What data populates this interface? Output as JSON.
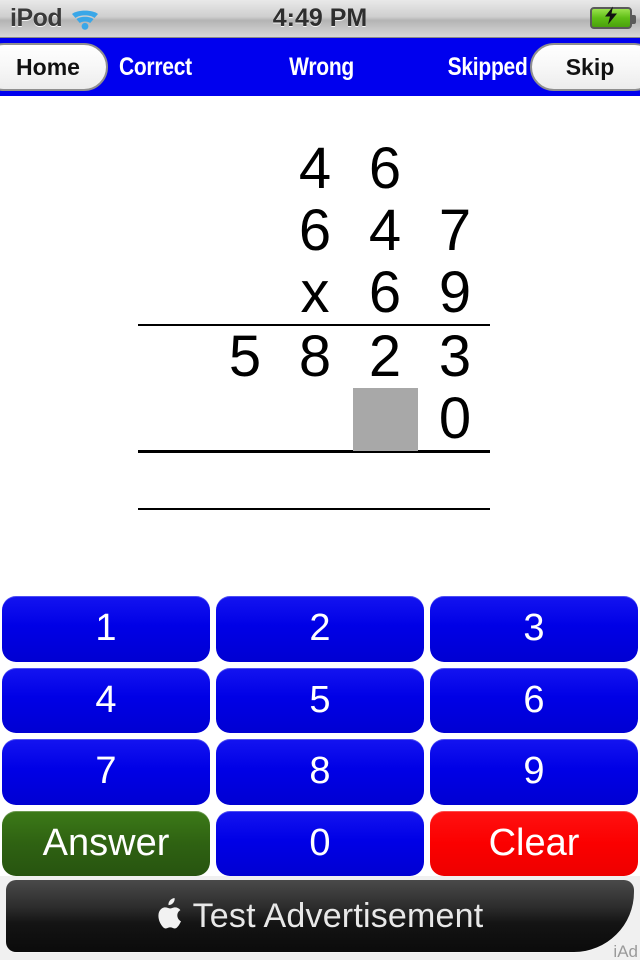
{
  "status_bar": {
    "carrier": "iPod",
    "wifi_icon": "wifi-icon",
    "time": "4:49 PM",
    "battery_icon": "battery-charging-icon"
  },
  "nav_bar": {
    "home_label": "Home",
    "correct_label": "Correct",
    "wrong_label": "Wrong",
    "skipped_label": "Skipped",
    "skip_label": "Skip",
    "background_color": "#0000ee"
  },
  "problem": {
    "type": "long-multiplication",
    "carry_row": [
      "",
      "",
      "4",
      "6",
      ""
    ],
    "multiplicand": [
      "",
      "",
      "6",
      "4",
      "7"
    ],
    "operator": "x",
    "multiplier_row": [
      "",
      "",
      "x",
      "6",
      "9"
    ],
    "partial_1": [
      "",
      "5",
      "8",
      "2",
      "3"
    ],
    "partial_2": [
      "",
      "",
      "",
      "█",
      "0"
    ],
    "partial_2_active_cell": "",
    "total_row": [
      "",
      "",
      "",
      "",
      ""
    ],
    "cursor_color": "#a8a8a8"
  },
  "keypad": {
    "keys": [
      {
        "label": "1",
        "style": "blue"
      },
      {
        "label": "2",
        "style": "blue"
      },
      {
        "label": "3",
        "style": "blue"
      },
      {
        "label": "4",
        "style": "blue"
      },
      {
        "label": "5",
        "style": "blue"
      },
      {
        "label": "6",
        "style": "blue"
      },
      {
        "label": "7",
        "style": "blue"
      },
      {
        "label": "8",
        "style": "blue"
      },
      {
        "label": "9",
        "style": "blue"
      },
      {
        "label": "Answer",
        "style": "green"
      },
      {
        "label": "0",
        "style": "blue"
      },
      {
        "label": "Clear",
        "style": "red"
      }
    ],
    "blue_color": "#0000e6",
    "green_color": "#2f6212",
    "red_color": "#fb0000"
  },
  "ad": {
    "logo_icon": "apple-logo-icon",
    "text": "Test Advertisement",
    "tag": "iAd"
  }
}
